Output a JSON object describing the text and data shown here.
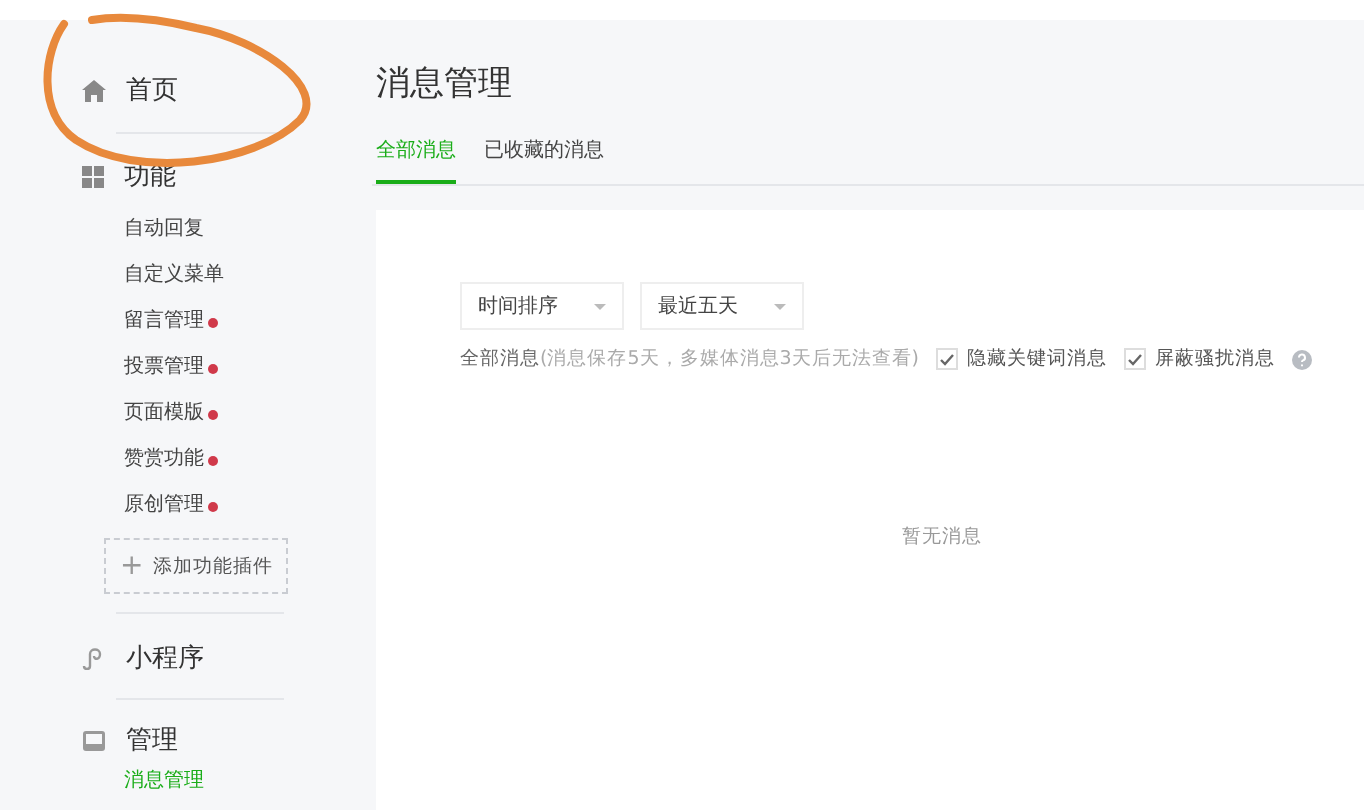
{
  "sidebar": {
    "sections": [
      {
        "kind": "home",
        "label": "首页"
      },
      {
        "kind": "features",
        "label": "功能",
        "items": [
          {
            "label": "自动回复",
            "badge": false,
            "selected": false
          },
          {
            "label": "自定义菜单",
            "badge": false,
            "selected": false
          },
          {
            "label": "留言管理",
            "badge": true,
            "selected": false
          },
          {
            "label": "投票管理",
            "badge": true,
            "selected": false
          },
          {
            "label": "页面模版",
            "badge": true,
            "selected": false
          },
          {
            "label": "赞赏功能",
            "badge": true,
            "selected": false
          },
          {
            "label": "原创管理",
            "badge": true,
            "selected": false
          }
        ],
        "add_button": {
          "icon": "+",
          "label": "添加功能插件"
        }
      },
      {
        "kind": "miniprogram",
        "label": "小程序"
      },
      {
        "kind": "manage",
        "label": "管理",
        "items": [
          {
            "label": "消息管理",
            "badge": false,
            "selected": true
          }
        ]
      }
    ]
  },
  "page": {
    "title": "消息管理",
    "tabs": [
      {
        "label": "全部消息",
        "selected": true
      },
      {
        "label": "已收藏的消息",
        "selected": false
      }
    ],
    "filters": [
      {
        "label": "时间排序"
      },
      {
        "label": "最近五天"
      }
    ],
    "info": {
      "label": "全部消息",
      "note": "(消息保存5天，多媒体消息3天后无法查看)"
    },
    "options": [
      {
        "label": "隐藏关键词消息",
        "checked": true
      },
      {
        "label": "屏蔽骚扰消息",
        "checked": true,
        "help": true
      }
    ],
    "empty": "暂无消息"
  }
}
